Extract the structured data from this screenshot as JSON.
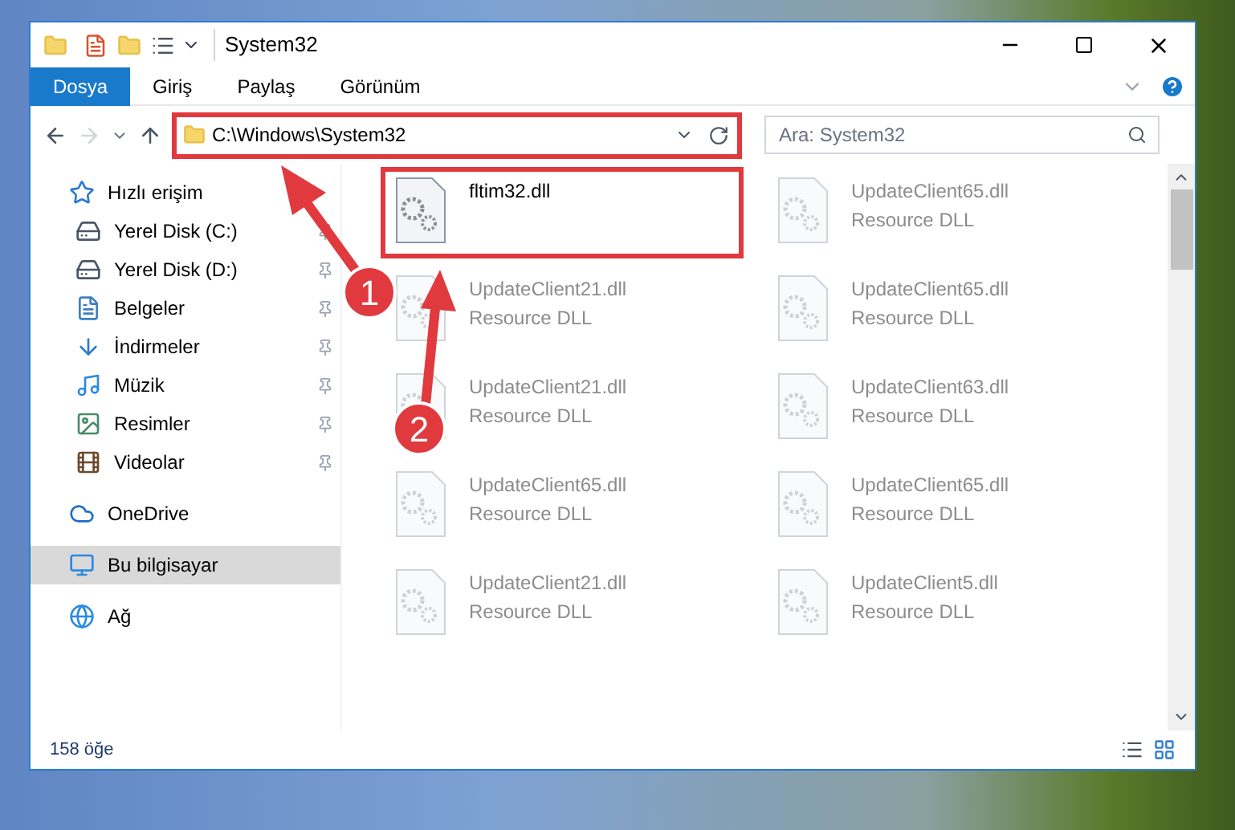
{
  "window": {
    "title": "System32"
  },
  "ribbon_tabs": [
    {
      "label": "Dosya",
      "selected": true
    },
    {
      "label": "Giriş",
      "selected": false
    },
    {
      "label": "Paylaş",
      "selected": false
    },
    {
      "label": "Görünüm",
      "selected": false
    }
  ],
  "address": {
    "value": "C:\\Windows\\System32"
  },
  "search": {
    "placeholder": "Ara: System32"
  },
  "sidebar": {
    "items": [
      {
        "label": "Hızlı erişim",
        "selected": false,
        "children": [
          {
            "label": "Yerel Disk (C:)",
            "selected": false,
            "pinned": true
          },
          {
            "label": "Yerel Disk (D:)",
            "selected": false,
            "pinned": true
          },
          {
            "label": "Belgeler",
            "selected": false,
            "pinned": true
          },
          {
            "label": "İndirmeler",
            "selected": false,
            "pinned": true
          },
          {
            "label": "Müzik",
            "selected": false,
            "pinned": true
          },
          {
            "label": "Resimler",
            "selected": false,
            "pinned": true
          },
          {
            "label": "Videolar",
            "selected": false,
            "pinned": true
          }
        ]
      },
      {
        "label": "OneDrive",
        "selected": false
      },
      {
        "label": "Bu bilgisayar",
        "selected": true
      },
      {
        "label": "Ağ",
        "selected": false
      }
    ]
  },
  "files": [
    {
      "name": "fltim32.dll",
      "highlighted": true
    },
    {
      "name": "UpdateClient65.dll",
      "type": "Resource DLL",
      "highlighted": false
    },
    {
      "name": "UpdateClient21.dll",
      "type": "Resource DLL",
      "highlighted": false
    },
    {
      "name": "UpdateClient65.dll",
      "type": "Resource DLL",
      "highlighted": false
    },
    {
      "name": "UpdateClient21.dll",
      "type": "Resource DLL",
      "highlighted": false
    },
    {
      "name": "UpdateClient63.dll",
      "type": "Resource DLL",
      "highlighted": false
    },
    {
      "name": "UpdateClient65.dll",
      "type": "Resource DLL",
      "highlighted": false
    },
    {
      "name": "UpdateClient65.dll",
      "type": "Resource DLL",
      "highlighted": false
    },
    {
      "name": "UpdateClient21.dll",
      "type": "Resource DLL",
      "highlighted": false
    },
    {
      "name": "UpdateClient5.dll",
      "type": "Resource DLL",
      "highlighted": false
    }
  ],
  "status_bar": {
    "count": "158 öğe"
  },
  "annotations": [
    {
      "number": "1"
    },
    {
      "number": "2"
    }
  ]
}
